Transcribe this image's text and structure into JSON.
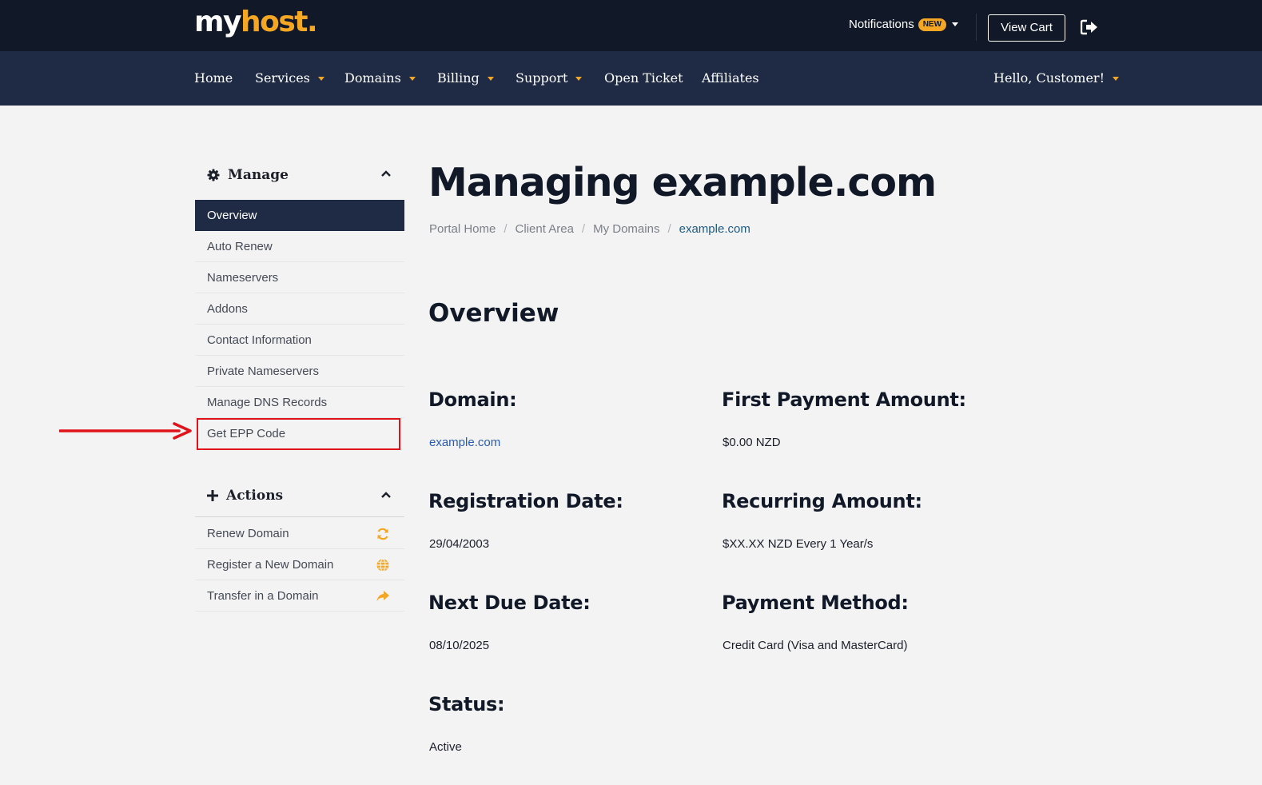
{
  "brand": {
    "logo_part1": "my",
    "logo_part2": "host."
  },
  "topbar": {
    "notifications_label": "Notifications",
    "notifications_badge": "NEW",
    "view_cart_label": "View Cart",
    "logout_icon": "sign-out-icon"
  },
  "nav": {
    "items": [
      {
        "label": "Home",
        "dropdown": false
      },
      {
        "label": "Services",
        "dropdown": true
      },
      {
        "label": "Domains",
        "dropdown": true
      },
      {
        "label": "Billing",
        "dropdown": true
      },
      {
        "label": "Support",
        "dropdown": true
      },
      {
        "label": "Open Ticket",
        "dropdown": false
      },
      {
        "label": "Affiliates",
        "dropdown": false
      }
    ],
    "user_menu_label": "Hello, Customer!"
  },
  "sidebar": {
    "manage": {
      "title": "Manage",
      "icon": "gear-icon",
      "items": [
        {
          "label": "Overview",
          "active": true
        },
        {
          "label": "Auto Renew"
        },
        {
          "label": "Nameservers"
        },
        {
          "label": "Addons"
        },
        {
          "label": "Contact Information"
        },
        {
          "label": "Private Nameservers"
        },
        {
          "label": "Manage DNS Records"
        },
        {
          "label": "Get EPP Code",
          "highlighted": true
        }
      ]
    },
    "actions": {
      "title": "Actions",
      "icon": "plus-icon",
      "items": [
        {
          "label": "Renew Domain",
          "icon": "refresh-icon"
        },
        {
          "label": "Register a New Domain",
          "icon": "globe-icon"
        },
        {
          "label": "Transfer in a Domain",
          "icon": "share-arrow-icon"
        }
      ]
    }
  },
  "main": {
    "title": "Managing example.com",
    "breadcrumb": [
      "Portal Home",
      "Client Area",
      "My Domains",
      "example.com"
    ],
    "section_title": "Overview",
    "fields": {
      "domain": {
        "label": "Domain:",
        "value": "example.com"
      },
      "first_payment": {
        "label": "First Payment Amount:",
        "value": "$0.00 NZD"
      },
      "registration_date": {
        "label": "Registration Date:",
        "value": "29/04/2003"
      },
      "recurring_amount": {
        "label": "Recurring Amount:",
        "value": "$XX.XX NZD Every 1 Year/s"
      },
      "next_due_date": {
        "label": "Next Due Date:",
        "value": "08/10/2025"
      },
      "payment_method": {
        "label": "Payment Method:",
        "value": "Credit Card (Visa and MasterCard)"
      },
      "status": {
        "label": "Status:",
        "value": "Active"
      }
    }
  },
  "colors": {
    "topbar_bg": "#111827",
    "navbar_bg": "#1f2a44",
    "accent": "#f5a623",
    "highlight_red": "#e1131a",
    "link_blue": "#2a5bb5"
  }
}
